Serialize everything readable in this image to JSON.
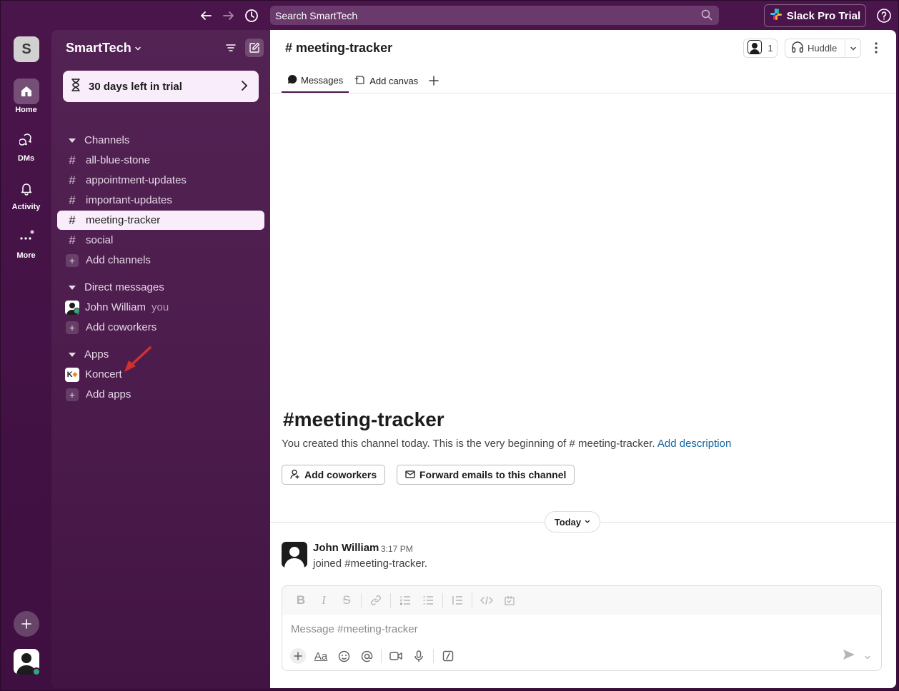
{
  "topbar": {
    "search_placeholder": "Search SmartTech",
    "pro_trial_label": "Slack Pro Trial"
  },
  "rail": {
    "workspace_initial": "S",
    "items": [
      {
        "label": "Home",
        "icon": "home-icon"
      },
      {
        "label": "DMs",
        "icon": "dm-icon"
      },
      {
        "label": "Activity",
        "icon": "bell-icon"
      },
      {
        "label": "More",
        "icon": "more-icon"
      }
    ]
  },
  "sidebar": {
    "workspace_name": "SmartTech",
    "trial_text": "30 days left in trial",
    "channels_header": "Channels",
    "channels": [
      "all-blue-stone",
      "appointment-updates",
      "important-updates",
      "meeting-tracker",
      "social"
    ],
    "add_channels": "Add channels",
    "dm_header": "Direct messages",
    "dm_user": "John William",
    "dm_you": "you",
    "add_coworkers": "Add coworkers",
    "apps_header": "Apps",
    "app_name": "Koncert",
    "app_logo_text": "K",
    "add_apps": "Add apps"
  },
  "channel": {
    "title": "meeting-tracker",
    "member_count": "1",
    "huddle_label": "Huddle",
    "tabs": {
      "messages": "Messages",
      "add_canvas": "Add canvas"
    },
    "intro_title": "meeting-tracker",
    "intro_text": "You created this channel today. This is the very beginning of # meeting-tracker.",
    "add_description": "Add description",
    "btn_add_coworkers": "Add coworkers",
    "btn_forward_emails": "Forward emails to this channel",
    "day_label": "Today"
  },
  "message": {
    "author": "John William",
    "time": "3:17 PM",
    "body": "joined #meeting-tracker."
  },
  "composer": {
    "placeholder": "Message #meeting-tracker",
    "format_label": "Aa"
  },
  "colors": {
    "aubergine": "#4a154b",
    "active_item_bg": "#f9edfb",
    "link": "#1264a3",
    "presence": "#2bac76"
  }
}
